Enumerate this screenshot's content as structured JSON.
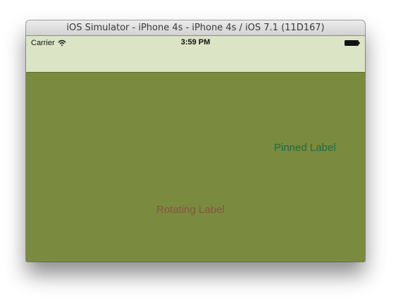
{
  "window": {
    "title": "iOS Simulator - iPhone 4s - iPhone 4s / iOS 7.1 (11D167)"
  },
  "status_bar": {
    "carrier": "Carrier",
    "time": "3:59 PM",
    "wifi_icon": "wifi-icon",
    "battery_icon": "battery-icon"
  },
  "content": {
    "pinned_label": "Pinned Label",
    "rotating_label": "Rotating Label"
  },
  "colors": {
    "background": "#7a8a3e",
    "status_bar": "#dce4c6",
    "pinned_label": "#1f6a45",
    "rotating_label": "#8a5346"
  }
}
